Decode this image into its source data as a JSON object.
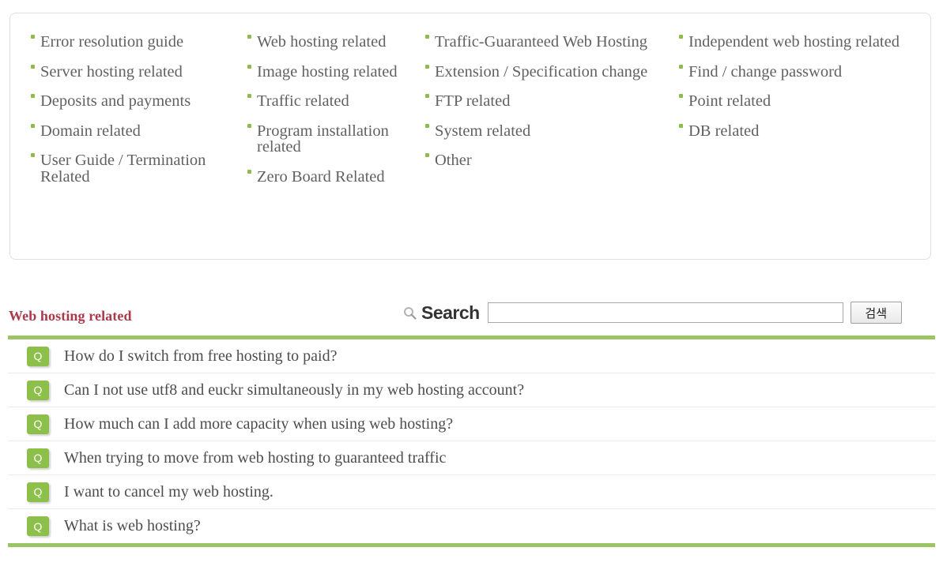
{
  "categories": {
    "columns": [
      {
        "items": [
          {
            "label": "Error resolution guide",
            "spacing": "normal"
          },
          {
            "label": "Server hosting related",
            "spacing": "gap-top"
          },
          {
            "label": "Deposits and payments",
            "spacing": "normal"
          },
          {
            "label": "Domain related",
            "spacing": "gap-top"
          },
          {
            "label": "User Guide / Termination Related",
            "spacing": "gap-top"
          }
        ]
      },
      {
        "items": [
          {
            "label": "Web hosting related",
            "spacing": "normal"
          },
          {
            "label": "Image hosting related",
            "spacing": "gap-top"
          },
          {
            "label": "Traffic related",
            "spacing": "normal"
          },
          {
            "label": "Program installation related",
            "spacing": "normal"
          },
          {
            "label": "Zero Board Related",
            "spacing": "gap-top"
          }
        ]
      },
      {
        "items": [
          {
            "label": "Traffic-Guaranteed Web Hosting",
            "spacing": "normal"
          },
          {
            "label": "Extension / Specification change",
            "spacing": "gap-top"
          },
          {
            "label": "FTP related",
            "spacing": "normal"
          },
          {
            "label": "System related",
            "spacing": "gap-top"
          },
          {
            "label": "Other",
            "spacing": "gap-top"
          }
        ]
      },
      {
        "items": [
          {
            "label": "Independent web hosting related",
            "spacing": "normal"
          },
          {
            "label": "Find / change password",
            "spacing": "normal"
          },
          {
            "label": "Point related",
            "spacing": "normal"
          },
          {
            "label": "DB related",
            "spacing": "gap-top"
          }
        ]
      }
    ]
  },
  "section": {
    "title": "Web hosting related"
  },
  "search": {
    "icon": "search-icon",
    "label": "Search",
    "value": "",
    "placeholder": "",
    "button_label": "검색"
  },
  "qa_list": {
    "badge_label": "Q",
    "items": [
      {
        "question": "How do I switch from free hosting to paid?"
      },
      {
        "question": "Can I not use utf8 and euckr simultaneously in my web hosting account?"
      },
      {
        "question": "How much can I add more capacity when using web hosting?"
      },
      {
        "question": "When trying to move from web hosting to guaranteed traffic"
      },
      {
        "question": "I want to cancel my web hosting."
      },
      {
        "question": "What is web hosting?"
      }
    ]
  },
  "colors": {
    "accent_green": "#9bc563",
    "badge_green": "#8cc04a",
    "bullet_green": "#8dbc4c",
    "title_maroon": "#a83a4c",
    "text_gray": "#616161",
    "panel_border": "#e0e0e0"
  }
}
